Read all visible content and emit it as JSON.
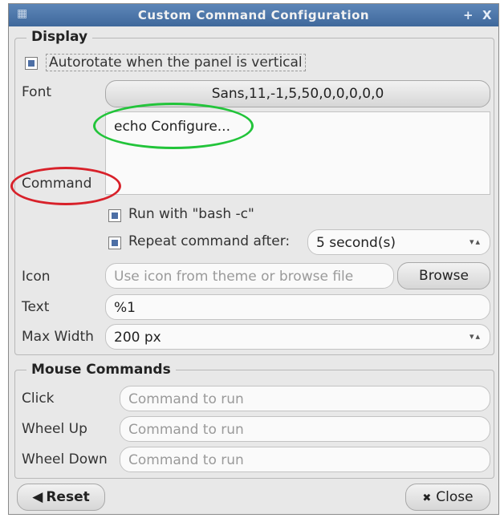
{
  "window": {
    "title": "Custom Command Configuration",
    "title_buttons": [
      "+",
      "X"
    ]
  },
  "display": {
    "legend": "Display",
    "autorotate": {
      "label": "Autorotate when the panel is vertical",
      "checked": true
    },
    "font": {
      "label": "Font",
      "value": "Sans,11,-1,5,50,0,0,0,0,0"
    },
    "command": {
      "label": "Command",
      "value": "echo Configure..."
    },
    "run_with_bash": {
      "label": "Run with \"bash -c\"",
      "checked": true
    },
    "repeat": {
      "label": "Repeat command after:",
      "checked": true,
      "value": "5 second(s)"
    },
    "icon": {
      "label": "Icon",
      "placeholder": "Use icon from theme or browse file",
      "browse_label": "Browse"
    },
    "text": {
      "label": "Text",
      "value": "%1"
    },
    "max_width": {
      "label": "Max Width",
      "value": "200 px"
    }
  },
  "mouse": {
    "legend": "Mouse Commands",
    "click": {
      "label": "Click",
      "placeholder": "Command to run"
    },
    "wheel_up": {
      "label": "Wheel Up",
      "placeholder": "Command to run"
    },
    "wheel_down": {
      "label": "Wheel Down",
      "placeholder": "Command to run"
    }
  },
  "footer": {
    "reset_label": "Reset",
    "close_label": "Close"
  },
  "annotations": {
    "command_oval_color": "#d8212a",
    "textarea_oval_color": "#22c43a"
  },
  "colors": {
    "titlebar": "#4a75a8",
    "checkbox_tick": "#4d6fa5"
  }
}
